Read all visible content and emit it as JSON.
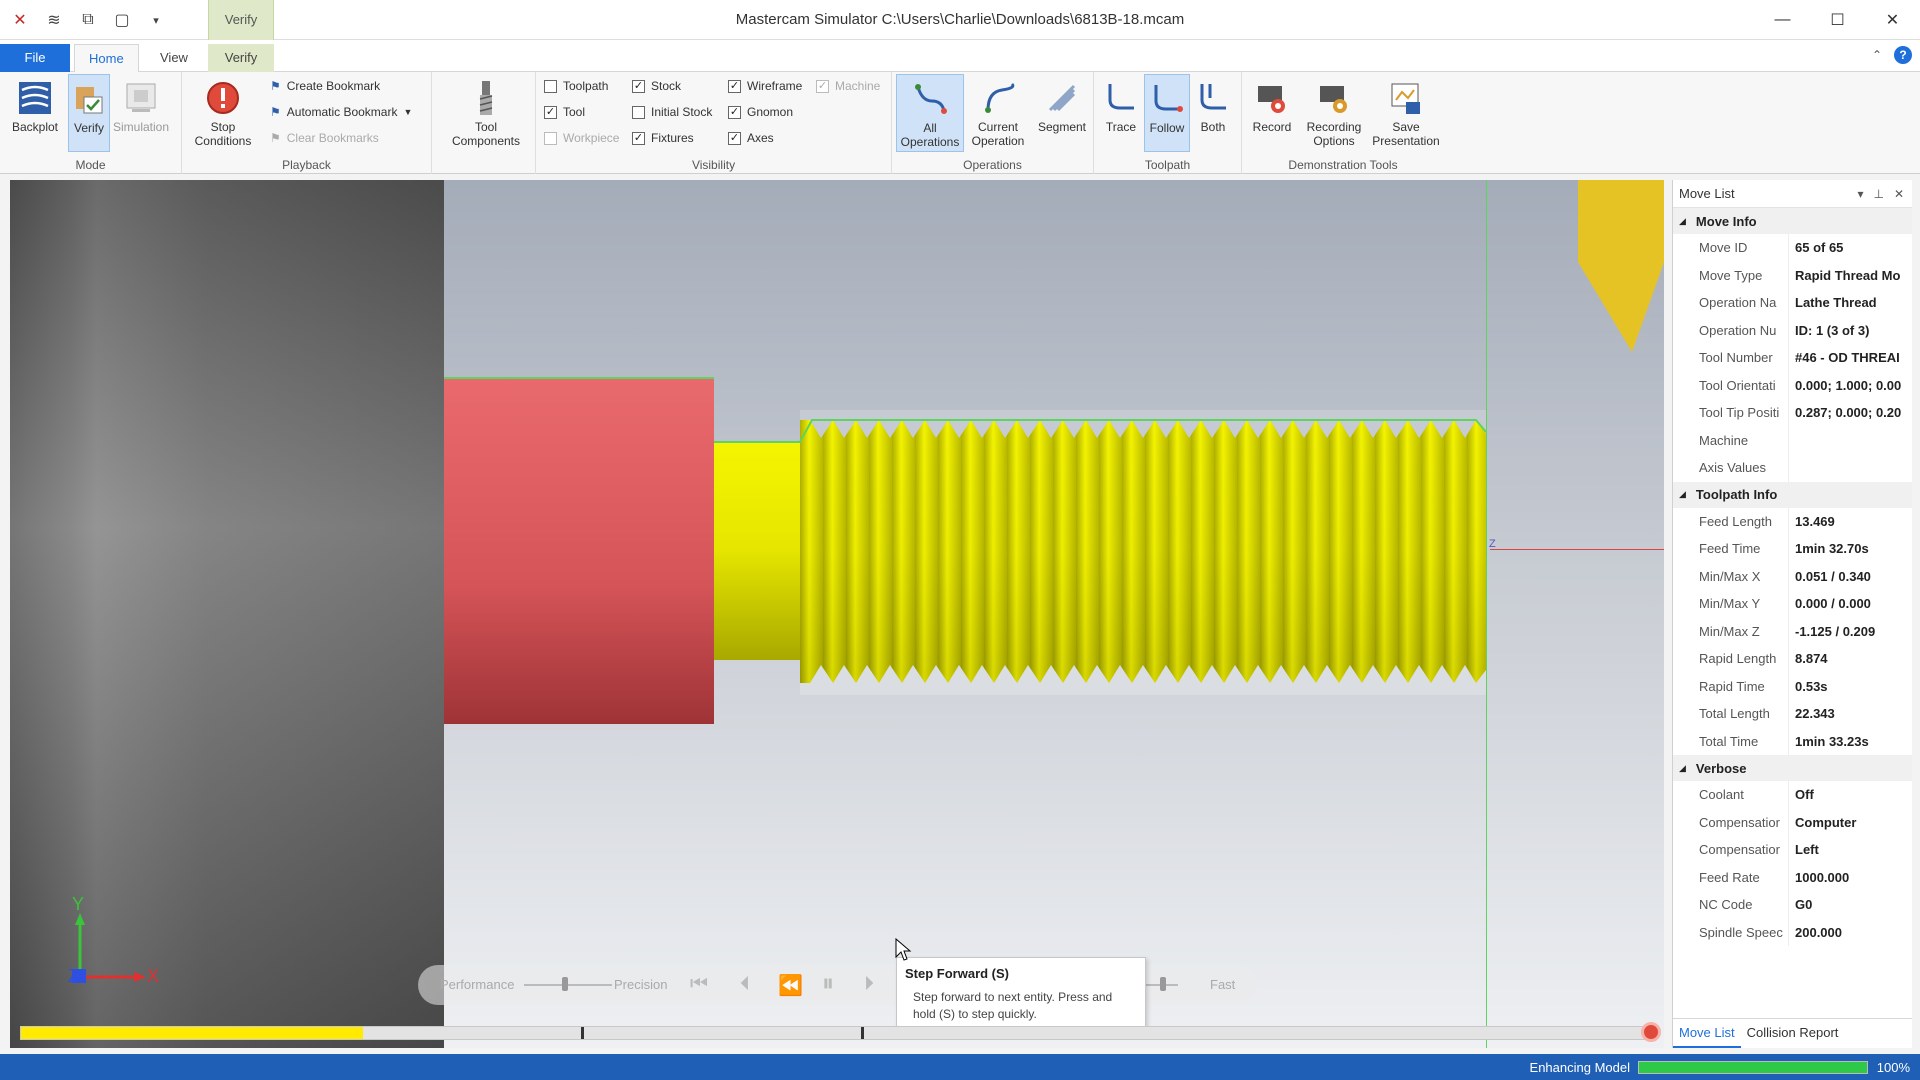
{
  "window": {
    "title": "Mastercam Simulator  C:\\Users\\Charlie\\Downloads\\6813B-18.mcam",
    "context_tab": "Verify"
  },
  "tabs": [
    {
      "label": "File"
    },
    {
      "label": "Home"
    },
    {
      "label": "View"
    },
    {
      "label": "Verify"
    }
  ],
  "ribbon": {
    "mode": {
      "label": "Mode",
      "backplot": "Backplot",
      "verify": "Verify",
      "simulation": "Simulation"
    },
    "playback": {
      "label": "Playback",
      "stop_conditions": "Stop\nConditions",
      "create_bookmark": "Create Bookmark",
      "automatic_bookmark": "Automatic Bookmark",
      "clear_bookmarks": "Clear Bookmarks"
    },
    "tool_components": "Tool\nComponents",
    "visibility": {
      "label": "Visibility",
      "items": [
        {
          "label": "Toolpath",
          "checked": false,
          "enabled": true
        },
        {
          "label": "Tool",
          "checked": true,
          "enabled": true
        },
        {
          "label": "Workpiece",
          "checked": false,
          "enabled": false
        },
        {
          "label": "Stock",
          "checked": true,
          "enabled": true
        },
        {
          "label": "Initial Stock",
          "checked": false,
          "enabled": true
        },
        {
          "label": "Fixtures",
          "checked": true,
          "enabled": true
        },
        {
          "label": "Wireframe",
          "checked": true,
          "enabled": true
        },
        {
          "label": "Gnomon",
          "checked": true,
          "enabled": true
        },
        {
          "label": "Axes",
          "checked": true,
          "enabled": true
        },
        {
          "label": "Machine",
          "checked": true,
          "enabled": false
        }
      ]
    },
    "operations": {
      "label": "Operations",
      "all": "All\nOperations",
      "current": "Current\nOperation",
      "segment": "Segment"
    },
    "toolpath": {
      "label": "Toolpath",
      "trace": "Trace",
      "follow": "Follow",
      "both": "Both"
    },
    "demo": {
      "label": "Demonstration Tools",
      "record": "Record",
      "recording_options": "Recording\nOptions",
      "save_presentation": "Save\nPresentation"
    }
  },
  "viewport": {
    "axis_y": "Y",
    "axis_x": "X",
    "axis_z": "Z",
    "z_marker": "Z"
  },
  "playbar": {
    "performance": "Performance",
    "precision": "Precision",
    "fast": "Fast"
  },
  "tooltip": {
    "title": "Step Forward (S)",
    "body": "Step forward to next entity. Press and hold (S) to step quickly."
  },
  "progress": {
    "value_percent": 21
  },
  "panel": {
    "title": "Move List",
    "sections": [
      {
        "title": "Move Info",
        "rows": [
          {
            "k": "Move ID",
            "v": "65 of 65"
          },
          {
            "k": "Move Type",
            "v": "Rapid Thread Mo"
          },
          {
            "k": "Operation Na",
            "v": "Lathe Thread"
          },
          {
            "k": "Operation Nu",
            "v": "ID: 1 (3 of 3)"
          },
          {
            "k": "Tool Number",
            "v": "#46 - OD THREAI"
          },
          {
            "k": "Tool Orientati",
            "v": "0.000; 1.000; 0.00"
          },
          {
            "k": "Tool Tip Positi",
            "v": "0.287; 0.000; 0.20"
          },
          {
            "k": "Machine",
            "v": ""
          },
          {
            "k": "Axis Values",
            "v": ""
          }
        ]
      },
      {
        "title": "Toolpath Info",
        "rows": [
          {
            "k": "Feed Length",
            "v": "13.469"
          },
          {
            "k": "Feed Time",
            "v": "1min 32.70s"
          },
          {
            "k": "Min/Max X",
            "v": "0.051 / 0.340"
          },
          {
            "k": "Min/Max Y",
            "v": "0.000 / 0.000"
          },
          {
            "k": "Min/Max Z",
            "v": "-1.125 / 0.209"
          },
          {
            "k": "Rapid Length",
            "v": "8.874"
          },
          {
            "k": "Rapid Time",
            "v": "0.53s"
          },
          {
            "k": "Total Length",
            "v": "22.343"
          },
          {
            "k": "Total Time",
            "v": "1min 33.23s"
          }
        ]
      },
      {
        "title": "Verbose",
        "rows": [
          {
            "k": "Coolant",
            "v": "Off"
          },
          {
            "k": "Compensatior",
            "v": "Computer"
          },
          {
            "k": "Compensatior",
            "v": "Left"
          },
          {
            "k": "Feed Rate",
            "v": "1000.000"
          },
          {
            "k": "NC Code",
            "v": "G0"
          },
          {
            "k": "Spindle Speec",
            "v": "200.000"
          }
        ]
      }
    ],
    "tabs": [
      "Move List",
      "Collision Report"
    ]
  },
  "status": {
    "text": "Enhancing Model",
    "percent_label": "100%",
    "percent_value": 100
  },
  "colors": {
    "accent": "#1e6fd9",
    "part_red": "#e0575b",
    "thread_yellow": "#e8e800",
    "status_bar": "#1f5fb5"
  }
}
